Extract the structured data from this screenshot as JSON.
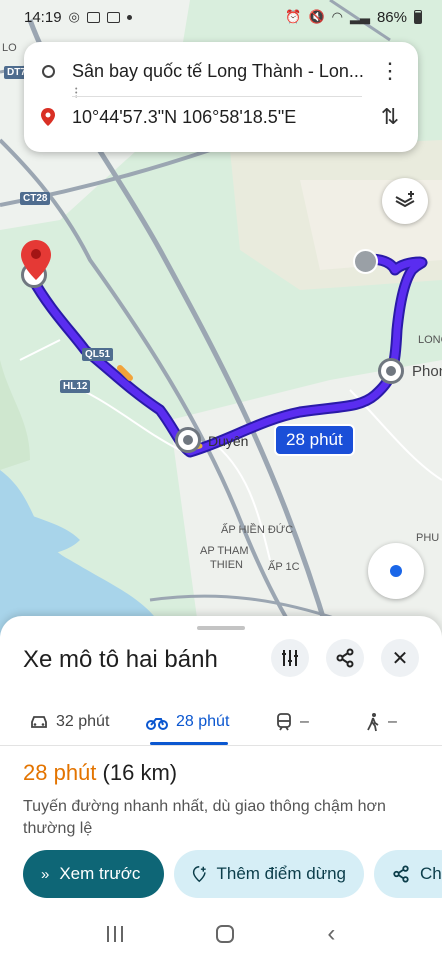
{
  "status_bar": {
    "time": "14:19",
    "battery": "86%"
  },
  "route_card": {
    "origin": "Sân bay quốc tế Long Thành - Lon...",
    "destination": "10°44'57.3\"N 106°58'18.5\"E"
  },
  "map": {
    "labels": {
      "loc_top_left": "LO",
      "dt7": "DT7",
      "ct28": "CT28",
      "ql51": "QL51",
      "hl12": "HL12",
      "duyen": "Duyên",
      "long": "LONG",
      "phon": "Phon",
      "phu": "PHU",
      "ap_hien_duc": "ẤP HIỀN ĐỨC",
      "ap_tham": "AP THAM",
      "thien": "THIEN",
      "ap_1c": "ẤP 1C"
    },
    "time_bubble": "28 phút",
    "route_color": "#4a1fd6",
    "accent_color": "#1a66e8"
  },
  "sheet": {
    "title": "Xe mô tô hai bánh",
    "modes": [
      {
        "icon": "car-icon",
        "label": "32 phút"
      },
      {
        "icon": "motorbike-icon",
        "label": "28 phút"
      },
      {
        "icon": "transit-icon",
        "label": "–"
      },
      {
        "icon": "walk-icon",
        "label": "–"
      }
    ],
    "summary_duration": "28 phút",
    "summary_distance": "(16 km)",
    "description": "Tuyến đường nhanh nhất, dù giao thông chậm hơn thường lệ",
    "actions": {
      "preview": "Xem trước",
      "add_stop": "Thêm điểm dừng",
      "share": "Chi"
    }
  }
}
